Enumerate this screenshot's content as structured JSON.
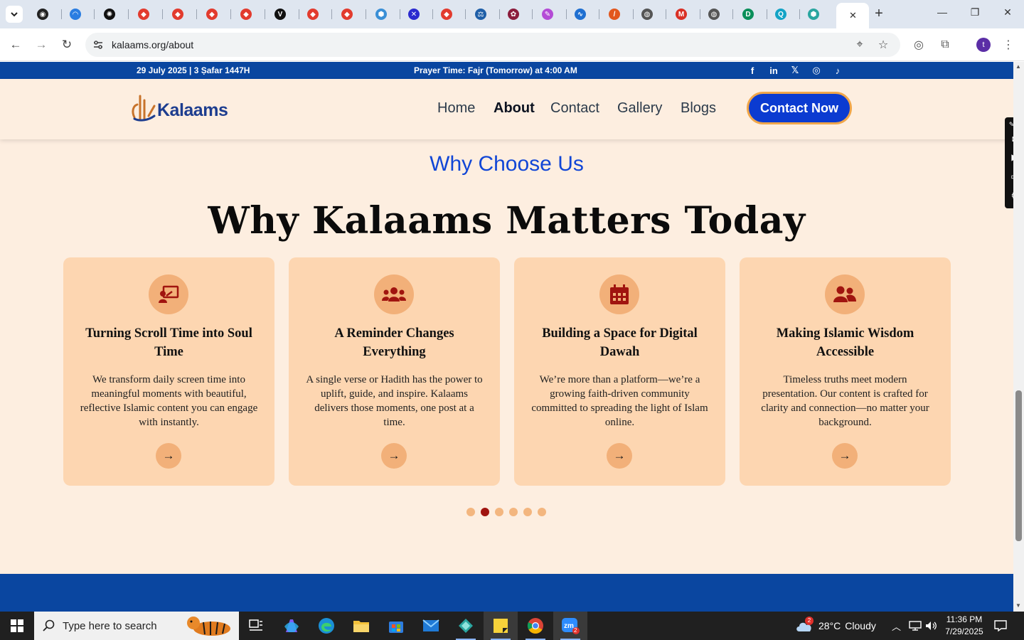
{
  "browser": {
    "url": "kalaams.org/about",
    "tabs": [
      {
        "icon": "tab-favicon"
      },
      {
        "icon": "tab-favicon"
      },
      {
        "icon": "tab-favicon"
      }
    ]
  },
  "topbar": {
    "date": "29 July 2025 | 3 Ṣafar 1447H",
    "prayer_prefix": "Prayer Time: ",
    "prayer_name": "Fajr (Tomorrow)",
    "prayer_suffix": " at 4:00 AM",
    "social": [
      "facebook-icon",
      "linkedin-icon",
      "x-icon",
      "instagram-icon",
      "tiktok-icon"
    ]
  },
  "header": {
    "logo_text": "Kalaams",
    "nav": [
      "Home",
      "About",
      "Contact",
      "Gallery",
      "Blogs"
    ],
    "active_nav": "About",
    "cta": "Contact Now"
  },
  "section": {
    "eyebrow": "Why Choose Us",
    "headline": "Why Kalaams Matters Today",
    "cards": [
      {
        "icon": "presentation-icon",
        "title": "Turning Scroll Time into Soul Time",
        "text": "We transform daily screen time into meaningful moments with beautiful, reflective Islamic content you can engage with instantly.",
        "arrow": "→"
      },
      {
        "icon": "users-icon",
        "title": "A Reminder Changes Everything",
        "text": "A single verse or Hadith has the power to uplift, guide, and inspire. Kalaams delivers those moments, one post at a time.",
        "arrow": "→"
      },
      {
        "icon": "calendar-icon",
        "title": "Building a Space for Digital Dawah",
        "text": "We’re more than a platform—we’re a growing faith-driven community committed to spreading the light of Islam online.",
        "arrow": "→"
      },
      {
        "icon": "user-friends-icon",
        "title": "Making Islamic Wisdom Accessible",
        "text": "Timeless truths meet modern presentation. Our content is crafted for clarity and connection—no matter your background.",
        "arrow": "→"
      }
    ],
    "carousel_dots": 6,
    "carousel_active": 2
  },
  "taskbar": {
    "search_placeholder": "Type here to search",
    "weather_temp": "28°C",
    "weather_desc": "Cloudy",
    "weather_badge": "2",
    "zoom_badge": "2",
    "time": "11:36 PM",
    "date": "7/29/2025"
  },
  "colors": {
    "brand_blue": "#0a46a0",
    "page_bg": "#fdeee0",
    "card_bg": "#fdd6b1",
    "accent_orange": "#f2b079",
    "icon_red": "#a0140f",
    "cta_blue": "#0b3bd1"
  }
}
